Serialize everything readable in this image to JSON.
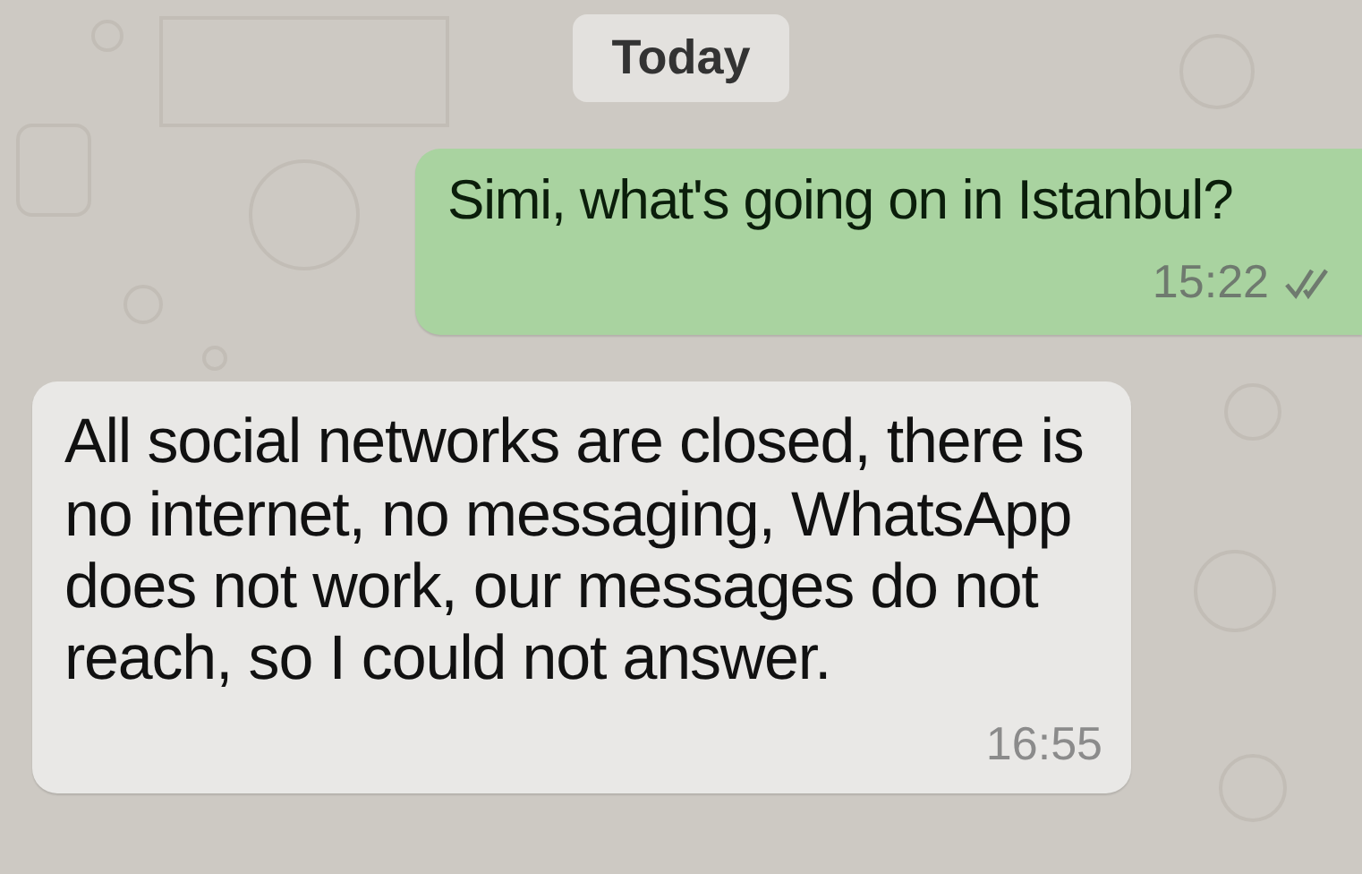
{
  "date_divider": "Today",
  "messages": [
    {
      "kind": "outgoing",
      "text": "Simi, what's going on in Istanbul?",
      "time": "15:22",
      "read": false
    },
    {
      "kind": "incoming",
      "text": "All social networks are closed, there is no internet, no messaging, WhatsApp does not work, our messages do not reach, so I could not answer.",
      "time": "16:55"
    }
  ]
}
